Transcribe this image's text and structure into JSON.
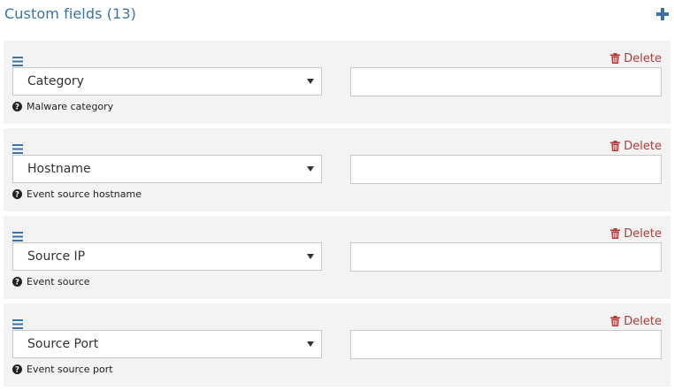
{
  "header": {
    "title": "Custom fields (13)"
  },
  "icons": {
    "add": "plus-icon",
    "drag": "hamburger-icon",
    "delete": "trash-icon",
    "help": "question-circle-icon"
  },
  "colors": {
    "title": "#3b72a8",
    "add_icon": "#3b72a8",
    "drag_icon": "#3b72a8",
    "delete": "#b23a3a",
    "row_background": "#f3f3f3"
  },
  "rows": [
    {
      "delete_label": "Delete",
      "select_value": "Category",
      "input_value": "",
      "help_text": "Malware category"
    },
    {
      "delete_label": "Delete",
      "select_value": "Hostname",
      "input_value": "",
      "help_text": "Event source hostname"
    },
    {
      "delete_label": "Delete",
      "select_value": "Source IP",
      "input_value": "",
      "help_text": "Event source"
    },
    {
      "delete_label": "Delete",
      "select_value": "Source Port",
      "input_value": "",
      "help_text": "Event source port"
    }
  ]
}
